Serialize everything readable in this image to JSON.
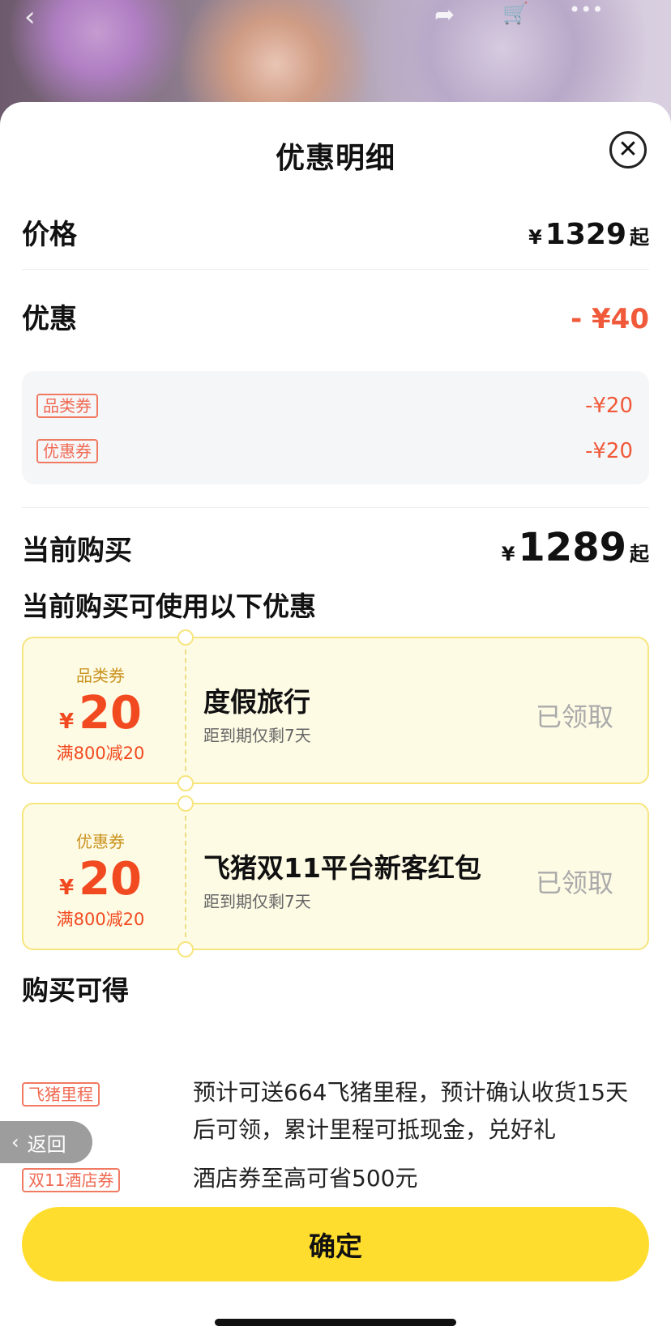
{
  "header_icons": {
    "back": "chevron-left-icon",
    "share": "share-icon",
    "cart": "cart-icon",
    "more": "more-icon"
  },
  "sheet": {
    "title": "优惠明细",
    "close_icon": "close-icon"
  },
  "price": {
    "label": "价格",
    "currency": "¥",
    "amount": "1329",
    "suffix": "起"
  },
  "discount": {
    "label": "优惠",
    "amount": "- ¥40",
    "items": [
      {
        "tag": "品类券",
        "amount": "-¥20"
      },
      {
        "tag": "优惠券",
        "amount": "-¥20"
      }
    ]
  },
  "current": {
    "label": "当前购买",
    "currency": "¥",
    "amount": "1289",
    "suffix": "起"
  },
  "available_title": "当前购买可使用以下优惠",
  "coupons": [
    {
      "type": "品类券",
      "currency": "¥",
      "value": "20",
      "condition": "满800减20",
      "name": "度假旅行",
      "expiry": "距到期仅剩7天",
      "status": "已领取"
    },
    {
      "type": "优惠券",
      "currency": "¥",
      "value": "20",
      "condition": "满800减20",
      "name": "飞猪双11平台新客红包",
      "expiry": "距到期仅剩7天",
      "status": "已领取"
    }
  ],
  "gain_title": "购买可得",
  "gains": [
    {
      "tag": "飞猪里程",
      "line1": "预计可送664飞猪里程，预计确认收货15天",
      "line2": "后可领，累计里程可抵现金，兑好礼"
    },
    {
      "tag": "双11酒店券",
      "line1": "酒店券至高可省500元"
    }
  ],
  "back_button": "返回",
  "confirm_button": "确定",
  "colors": {
    "accent": "#ffdd2e",
    "discount_red": "#f05a3a",
    "coupon_bg": "#fefbe5"
  }
}
